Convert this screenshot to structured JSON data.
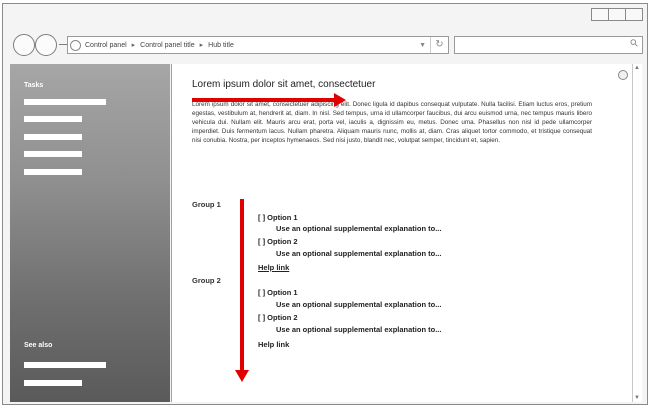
{
  "breadcrumb": [
    "Control panel",
    "Control panel title",
    "Hub title"
  ],
  "sidebar": {
    "tasks_heading": "Tasks",
    "see_also_heading": "See also"
  },
  "main": {
    "title": "Lorem ipsum dolor sit amet, consectetuer",
    "body": "Lorem ipsum dolor sit amet, consectetuer adipiscing elit. Donec ligula id dapibus consequat vulputate. Nulla facilisi. Etiam luctus eros, pretium egestas, vestibulum at, hendrerit at, diam. In nisl. Sed tempus, urna id ullamcorper faucibus, dui arcu euismod urna, nec tempus mauris libero vehicula dui. Nullam elit. Mauris arcu erat, porta vel, iaculis a, dignissim eu, metus. Donec uma. Phasellus non nisl id pede ullamcorper imperdiet. Duis fermentum lacus. Nullam pharetra. Aliquam mauris nunc, mollis at, diam. Cras aliquet tortor commodo, et tristique consequat nisi conubia. Nostra, per inceptos hymenaeos. Sed nisi justo, blandit nec, volutpat semper, tincidunt et, sapien.",
    "groups": [
      {
        "label": "Group 1",
        "options": [
          {
            "label": "[  ] Option 1",
            "desc": "Use an optional supplemental explanation to..."
          },
          {
            "label": "[  ] Option 2",
            "desc": "Use an optional supplemental explanation to..."
          }
        ],
        "help_link": "Help link"
      },
      {
        "label": "Group 2",
        "options": [
          {
            "label": "[  ] Option 1",
            "desc": "Use an optional supplemental explanation to..."
          },
          {
            "label": "[  ] Option 2",
            "desc": "Use an optional supplemental explanation to..."
          }
        ],
        "help_link": "Help link"
      }
    ]
  },
  "colors": {
    "annotation_arrow": "#e00000",
    "sidebar_top": "#a6a6a6",
    "sidebar_bottom": "#5a5a5a"
  }
}
